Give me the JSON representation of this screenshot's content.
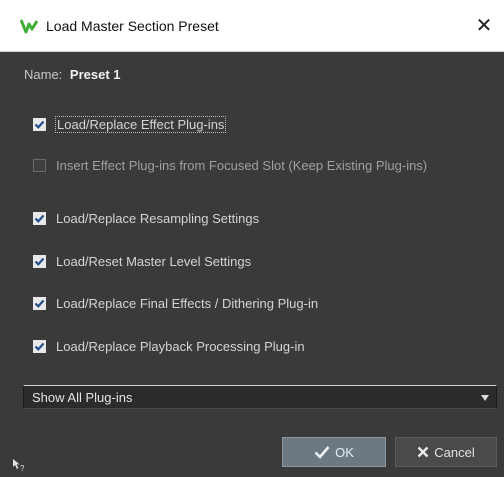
{
  "dialog": {
    "title": "Load Master Section Preset",
    "close_glyph": "✕",
    "logo_icon": "wavelab-logo-icon"
  },
  "name_row": {
    "label": "Name:",
    "value": "Preset 1"
  },
  "options": [
    {
      "label": "Load/Replace Effect Plug-ins",
      "checked": true
    },
    {
      "label": "Insert Effect Plug-ins from Focused Slot (Keep Existing Plug-ins)",
      "checked": false
    },
    {
      "label": "Load/Replace Resampling Settings",
      "checked": true
    },
    {
      "label": "Load/Reset Master Level Settings",
      "checked": true
    },
    {
      "label": "Load/Replace Final Effects / Dithering Plug-in",
      "checked": true
    },
    {
      "label": "Load/Replace Playback Processing Plug-in",
      "checked": true
    }
  ],
  "filter_dropdown": {
    "selected": "Show All Plug-ins"
  },
  "buttons": {
    "ok": "OK",
    "cancel": "Cancel"
  },
  "colors": {
    "background": "#3a3a3a",
    "titlebar": "#ffffff",
    "logo_green": "#3fae34",
    "ok_button": "#6c7983"
  }
}
